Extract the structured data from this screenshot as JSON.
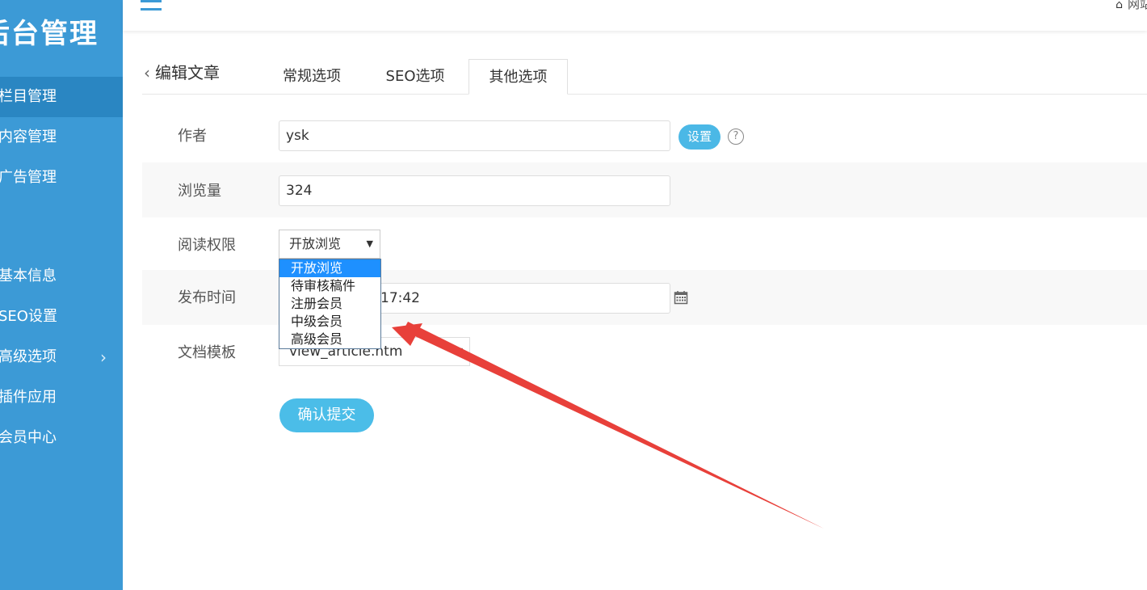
{
  "sidebar": {
    "logo": "后台管理",
    "items": [
      {
        "label": "栏目管理",
        "active": true
      },
      {
        "label": "内容管理"
      },
      {
        "label": "广告管理"
      },
      {
        "label": "基本信息"
      },
      {
        "label": "SEO设置"
      },
      {
        "label": "高级选项",
        "has_chevron": true
      },
      {
        "label": "插件应用"
      },
      {
        "label": "会员中心"
      }
    ]
  },
  "topbar": {
    "menu_icon": "hamburger-icon",
    "site_link": "网站",
    "home_icon": "home-icon"
  },
  "page": {
    "back_label": "编辑文章",
    "tabs": [
      {
        "label": "常规选项"
      },
      {
        "label": "SEO选项"
      },
      {
        "label": "其他选项",
        "active": true
      }
    ]
  },
  "form": {
    "author": {
      "label": "作者",
      "value": "ysk",
      "set_button": "设置",
      "help_icon": "question-circle-icon"
    },
    "views": {
      "label": "浏览量",
      "value": "324"
    },
    "permission": {
      "label": "阅读权限",
      "selected": "开放浏览",
      "options": [
        "开放浏览",
        "待审核稿件",
        "注册会员",
        "中级会员",
        "高级会员"
      ]
    },
    "publish_time": {
      "label": "发布时间",
      "value_visible": "17:42",
      "calendar_icon": "calendar-icon"
    },
    "template": {
      "label": "文档模板",
      "value": "view_article.htm"
    },
    "submit_label": "确认提交"
  },
  "annotation": {
    "arrow_color": "#e8403a"
  },
  "colors": {
    "sidebar": "#3c9ad6",
    "accent": "#4bbde8",
    "dropdown_highlight": "#1e90ff"
  }
}
